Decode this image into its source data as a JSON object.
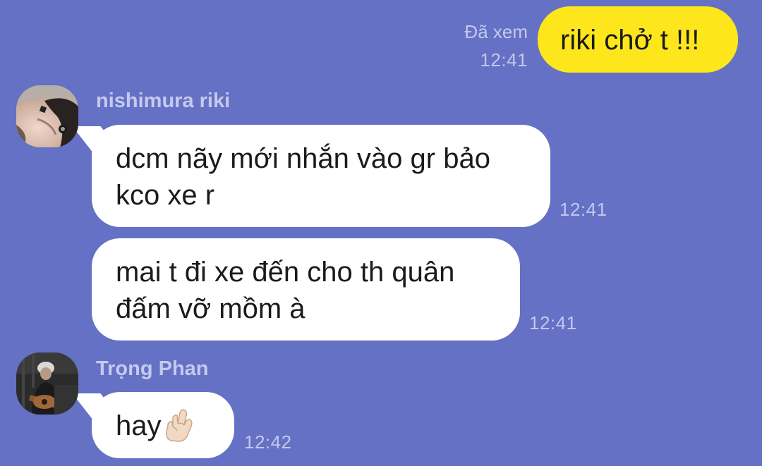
{
  "conversation": {
    "outgoing": {
      "text": "riki chở t !!!",
      "status": "Đã xem",
      "time": "12:41"
    },
    "senders": [
      {
        "name": "nishimura riki",
        "avatar_icon": "profile-photo-icon",
        "messages": [
          {
            "text": "dcm nãy mới nhắn vào gr bảo kco xe r",
            "time": "12:41"
          },
          {
            "text": "mai t đi xe đến cho th quân đấm vỡ mồm à",
            "time": "12:41"
          }
        ]
      },
      {
        "name": "Trọng Phan",
        "avatar_icon": "profile-photo-icon",
        "messages": [
          {
            "text": "hay",
            "time": "12:42",
            "emoji": "crossed-fingers-icon"
          }
        ]
      }
    ]
  },
  "colors": {
    "background": "#6471c4",
    "outgoing_bubble": "#fde71c",
    "incoming_bubble": "#ffffff",
    "meta_text": "#c3c8ec"
  }
}
